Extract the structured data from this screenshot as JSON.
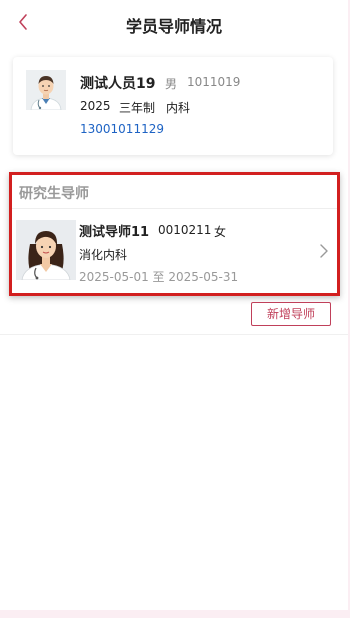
{
  "header": {
    "title": "学员导师情况",
    "back_icon": "chevron-left-icon",
    "accent_color": "#c0405a"
  },
  "student": {
    "name": "测试人员19",
    "gender": "男",
    "id": "1011019",
    "year": "2025",
    "program": "三年制",
    "department": "内科",
    "phone": "13001011129",
    "avatar": "male-doctor-avatar"
  },
  "mentor_section": {
    "title": "研究生导师",
    "mentors": [
      {
        "name": "测试导师11",
        "code": "0010211",
        "gender": "女",
        "department": "消化内科",
        "period": "2025-05-01 至 2025-05-31",
        "photo": "female-doctor-photo"
      }
    ]
  },
  "actions": {
    "add_mentor_label": "新增导师"
  },
  "colors": {
    "link": "#1e63c4",
    "highlight_border": "#d21f1f",
    "button_border": "#c0405a"
  }
}
